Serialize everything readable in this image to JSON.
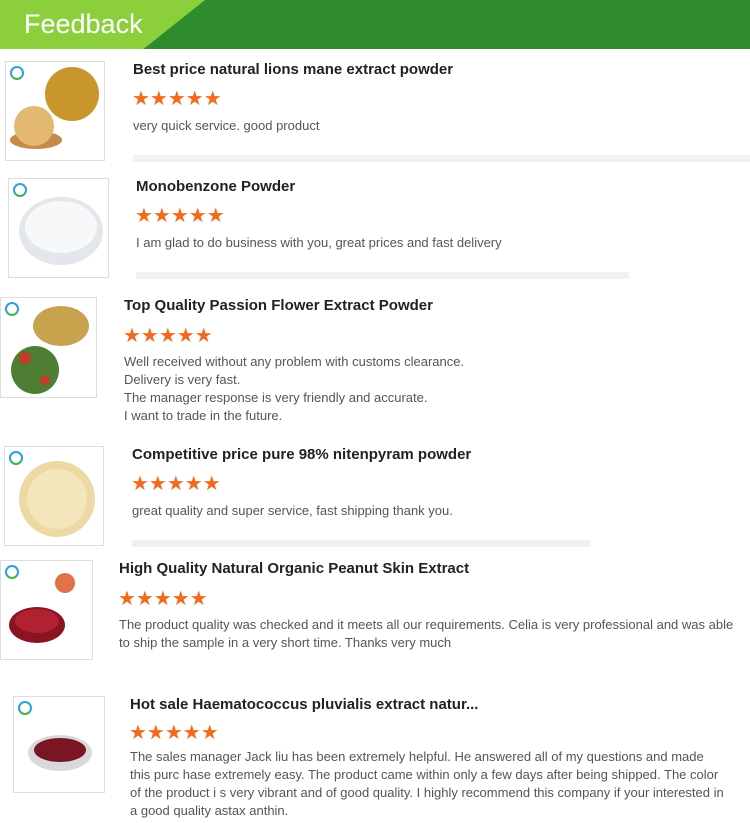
{
  "header": {
    "title": "Feedback"
  },
  "reviews": [
    {
      "product": "Best price natural lions mane extract powder",
      "stars": "★★★★★",
      "rating": 5,
      "comment": "very quick service. good product"
    },
    {
      "product": "Monobenzone Powder",
      "stars": "★★★★★",
      "rating": 5,
      "comment": "I am glad to do business with you, great prices and fast delivery"
    },
    {
      "product": "Top Quality Passion Flower Extract Powder",
      "stars": "★★★★★",
      "rating": 5,
      "comment_lines": [
        "Well received without any problem with customs clearance.",
        "Delivery is very fast.",
        "The manager response is very friendly and accurate.",
        "I want to trade in the future."
      ]
    },
    {
      "product": "Competitive price pure 98% nitenpyram powder",
      "stars": "★★★★★",
      "rating": 5,
      "comment": "great quality and super service, fast shipping thank you."
    },
    {
      "product": "High Quality Natural Organic Peanut Skin Extract",
      "stars": "★★★★★",
      "rating": 5,
      "comment": "The product quality was checked and it meets all our requirements. Celia is very professional and was able to ship the sample in a very short time. Thanks very much"
    },
    {
      "product": "Hot sale Haematococcus pluvialis extract natur...",
      "stars": "★★★★★",
      "rating": 5,
      "comment": "The sales manager Jack liu has been extremely helpful. He answered all of my questions and made this purc hase extremely easy. The product came within only a few days after being shipped. The color of the product i s very vibrant and of good quality. I highly recommend this company if your interested in a good quality astax anthin."
    }
  ],
  "colors": {
    "header_green": "#2e8b2e",
    "header_light": "#8bd03c",
    "star_orange": "#f26b1d"
  }
}
